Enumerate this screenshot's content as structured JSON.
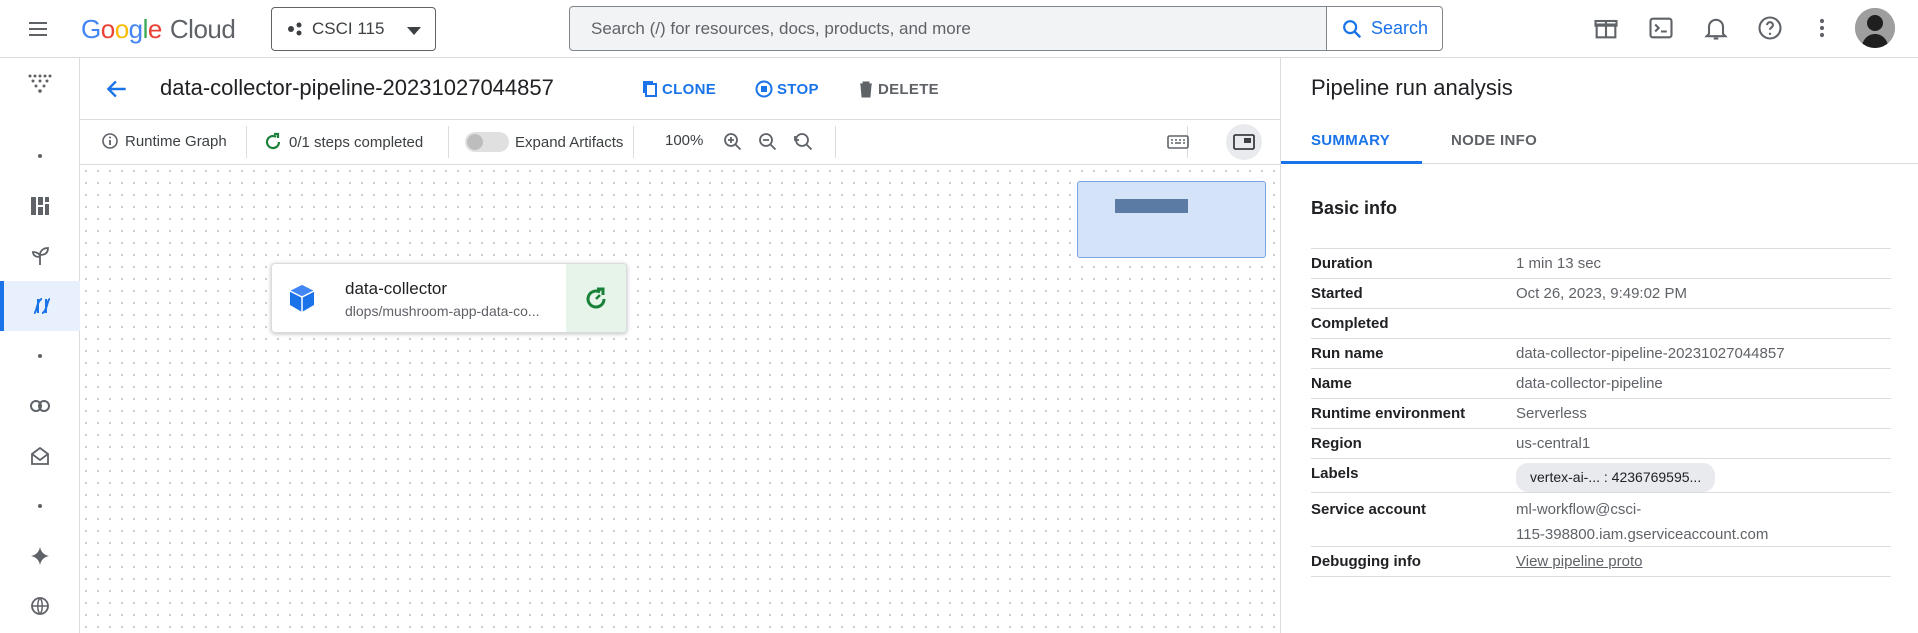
{
  "topbar": {
    "logo": {
      "g1": "G",
      "g2": "o",
      "g3": "o",
      "g4": "g",
      "g5": "l",
      "g6": "e",
      "product": "Cloud"
    },
    "project": "CSCI 115",
    "search_placeholder": "Search (/) for resources, docs, products, and more",
    "search_button": "Search",
    "icons": [
      "gift-icon",
      "cloud-shell-icon",
      "notifications-icon",
      "help-icon",
      "more-vert-icon"
    ]
  },
  "header": {
    "run_title": "data-collector-pipeline-20231027044857",
    "clone": "CLONE",
    "stop": "STOP",
    "delete": "DELETE"
  },
  "toolbar": {
    "runtime_graph": "Runtime Graph",
    "steps": "0/1 steps completed",
    "expand_artifacts": "Expand Artifacts",
    "zoom": "100%"
  },
  "node": {
    "title": "data-collector",
    "subtitle": "dlops/mushroom-app-data-co..."
  },
  "panel": {
    "title": "Pipeline run analysis",
    "tabs": [
      "SUMMARY",
      "NODE INFO"
    ],
    "section": "Basic info",
    "rows": [
      {
        "label": "Duration",
        "value": "1 min 13 sec"
      },
      {
        "label": "Started",
        "value": "Oct 26, 2023, 9:49:02 PM"
      },
      {
        "label": "Completed",
        "value": ""
      },
      {
        "label": "Run name",
        "value": "data-collector-pipeline-20231027044857"
      },
      {
        "label": "Name",
        "value": "data-collector-pipeline"
      },
      {
        "label": "Runtime environment",
        "value": "Serverless"
      },
      {
        "label": "Region",
        "value": "us-central1"
      },
      {
        "label": "Labels",
        "value": "vertex-ai-... : 4236769595..."
      },
      {
        "label": "Service account",
        "value": "ml-workflow@csci-",
        "value2": "115-398800.iam.gserviceaccount.com"
      },
      {
        "label": "Debugging info",
        "value": "View pipeline proto"
      }
    ]
  },
  "colors": {
    "accent": "#1a73e8",
    "success": "#188038"
  }
}
